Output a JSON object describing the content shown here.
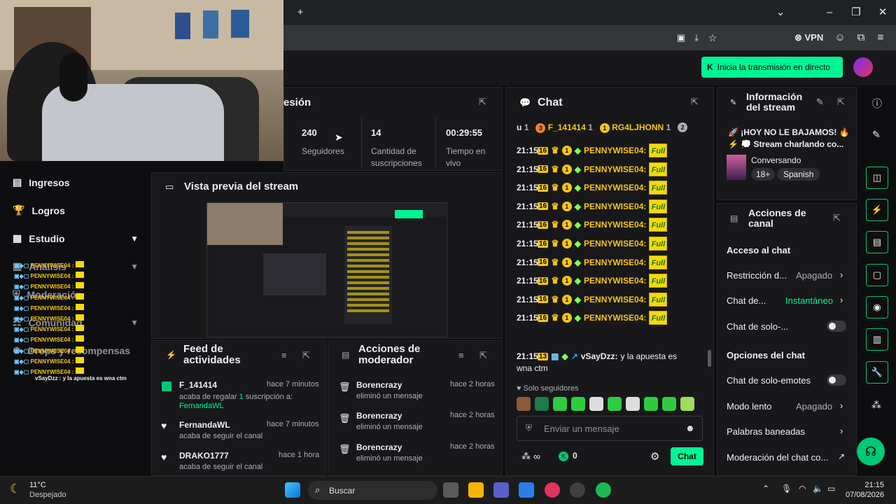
{
  "browser": {
    "vpn_label": "VPN",
    "golive_label": "Inicia la transmisión en directo"
  },
  "sidebar": {
    "items": [
      {
        "label": "Ingresos",
        "icon": "bar-chart-icon"
      },
      {
        "label": "Logros",
        "icon": "trophy-icon"
      },
      {
        "label": "Estudio",
        "icon": "studio-icon"
      },
      {
        "label": "Análisis",
        "icon": "analytics-icon"
      },
      {
        "label": "Moderación",
        "icon": "shield-icon"
      },
      {
        "label": "Comunidad",
        "icon": "community-icon"
      },
      {
        "label": "Drops y recompensas",
        "icon": "gift-icon"
      }
    ]
  },
  "overlay_chat": {
    "lines": [
      "PENNYWISE04 :",
      "PENNYWISE04 :",
      "PENNYWISE04 :",
      "PENNYWISE04 :",
      "PENNYWISE04 :",
      "PENNYWISE04 :",
      "PENNYWISE04 :",
      "PENNYWISE04 :",
      "PENNYWISE04 :",
      "PENNYWISE04 :",
      "PENNYWISE04 :"
    ],
    "last": "vSayDzz : y la apuesta es wna ctm"
  },
  "session": {
    "title": "esión",
    "stats": [
      {
        "value": "240",
        "label": "Seguidores"
      },
      {
        "value": "14",
        "label": "Cantidad de suscripciones"
      },
      {
        "value": "00:29:55",
        "label": "Tiempo en vivo"
      }
    ]
  },
  "preview": {
    "title": "Vista previa del stream"
  },
  "activity": {
    "title": "Feed de actividades",
    "items": [
      {
        "user": "F_141414",
        "time": "hace 7 minutos",
        "text_pre": "acaba de regalar",
        "count": "1",
        "text_mid": "suscripción a:",
        "target": "FernandaWL"
      },
      {
        "user": "FernandaWL",
        "time": "hace 7 minutos",
        "text": "acaba de seguir el canal"
      },
      {
        "user": "DRAKO1777",
        "time": "hace 1 hora",
        "text": "acaba de seguir el canal"
      }
    ]
  },
  "modactions": {
    "title": "Acciones de moderador",
    "items": [
      {
        "user": "Borencrazy",
        "time": "hace 2 horas",
        "text": "eliminó un mensaje"
      },
      {
        "user": "Borencrazy",
        "time": "hace 2 horas",
        "text": "eliminó un mensaje"
      },
      {
        "user": "Borencrazy",
        "time": "hace 2 horas",
        "text": "eliminó un mensaje"
      }
    ]
  },
  "chat": {
    "title": "Chat",
    "pinned": [
      {
        "prefix": "u",
        "count": "1"
      },
      {
        "badge": "3",
        "user": "F_141414",
        "count": "1"
      },
      {
        "badge": "1",
        "user": "RG4LJHONN",
        "count": "1"
      },
      {
        "badge": "2"
      }
    ],
    "messages": [
      {
        "time": "21:15",
        "badge": "16",
        "user": "PENNYWISE04:",
        "emote": "Full"
      },
      {
        "time": "21:15",
        "badge": "16",
        "user": "PENNYWISE04:",
        "emote": "Full"
      },
      {
        "time": "21:15",
        "badge": "16",
        "user": "PENNYWISE04:",
        "emote": "Full"
      },
      {
        "time": "21:15",
        "badge": "16",
        "user": "PENNYWISE04:",
        "emote": "Full"
      },
      {
        "time": "21:15",
        "badge": "16",
        "user": "PENNYWISE04:",
        "emote": "Full"
      },
      {
        "time": "21:15",
        "badge": "16",
        "user": "PENNYWISE04:",
        "emote": "Full"
      },
      {
        "time": "21:15",
        "badge": "16",
        "user": "PENNYWISE04:",
        "emote": "Full"
      },
      {
        "time": "21:15",
        "badge": "16",
        "user": "PENNYWISE04:",
        "emote": "Full"
      },
      {
        "time": "21:15",
        "badge": "16",
        "user": "PENNYWISE04:",
        "emote": "Full"
      },
      {
        "time": "21:15",
        "badge": "16",
        "user": "PENNYWISE04:",
        "emote": "Full"
      }
    ],
    "last_message": {
      "time": "21:15",
      "badge": "13",
      "user": "vSayDzz:",
      "text": "y la apuesta es",
      "text2": "wna ctm"
    },
    "followers_only": "Solo seguidores",
    "input_placeholder": "Enviar un mensaje",
    "points": "0",
    "send_label": "Chat"
  },
  "stream_info": {
    "title_line1": "Información",
    "title_line2": "del stream",
    "stream_title1": "🚀 ¡HOY NO LE BAJAMOS! 🔥",
    "stream_title2": "⚡ 💭 Stream charlando co...",
    "category": "Conversando",
    "tags": [
      "18+",
      "Spanish"
    ]
  },
  "channel_actions": {
    "title_line1": "Acciones de",
    "title_line2": "canal",
    "section1": "Acceso al chat",
    "rows1": [
      {
        "label": "Restricción d...",
        "value": "Apagado"
      },
      {
        "label": "Chat de...",
        "value": "Instantáneo"
      },
      {
        "label": "Chat de solo-...",
        "value": ""
      }
    ],
    "section2": "Opciones del chat",
    "rows2": [
      {
        "label": "Chat de solo-emotes",
        "value": ""
      },
      {
        "label": "Modo lento",
        "value": "Apagado"
      },
      {
        "label": "Palabras baneadas",
        "value": ""
      },
      {
        "label": "Moderación del chat co...",
        "value": ""
      }
    ],
    "accent_color": "#00f593",
    "instant_color": "#00f593"
  },
  "taskbar": {
    "temp": "11°C",
    "weather": "Despejado",
    "search": "Buscar",
    "time": "21:15",
    "date": "07/08/2026"
  }
}
